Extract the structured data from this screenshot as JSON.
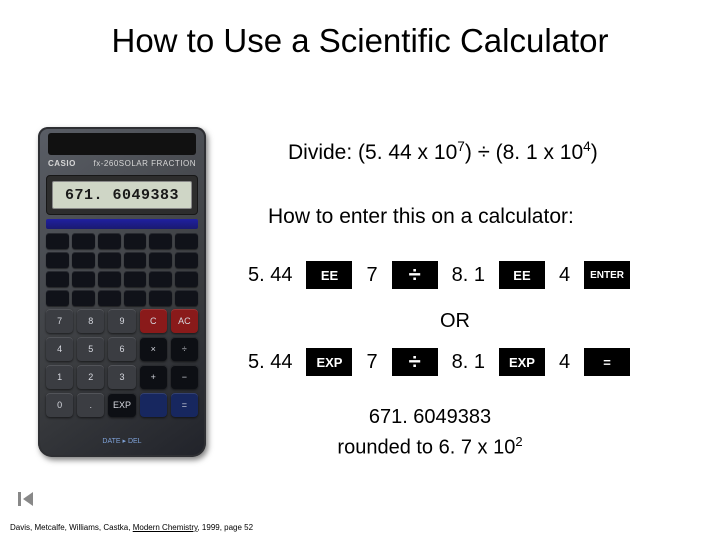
{
  "title": "How to Use a Scientific Calculator",
  "calculator": {
    "brand_left": "CASIO",
    "brand_right": "fx-260SOLAR  FRACTION",
    "display": "671. 6049383",
    "bottom_label": "DATE ▸ DEL"
  },
  "problem": {
    "prefix": "Divide:  (5. 44 x 10",
    "exp1": "7",
    "mid": ") ",
    "divsym": "÷",
    "mid2": " (8. 1 x 10",
    "exp2": "4",
    "suffix": ")"
  },
  "howenter": "How to enter this on a calculator:",
  "seq": {
    "n1": "5. 44",
    "ee": "EE",
    "n2": "7",
    "div": "÷",
    "n3": "8. 1",
    "ee2": "EE",
    "n4": "4",
    "enter": "ENTER",
    "exp": "EXP",
    "eq": "="
  },
  "or": "OR",
  "result_value": "671. 6049383",
  "rounded": {
    "prefix": "rounded to 6. 7 x 10",
    "exp": "2"
  },
  "footer": {
    "authors": "Davis, Metcalfe, Williams, Castka, ",
    "book": "Modern Chemistry",
    "rest": ", 1999,  page 52"
  },
  "nav": "previous"
}
